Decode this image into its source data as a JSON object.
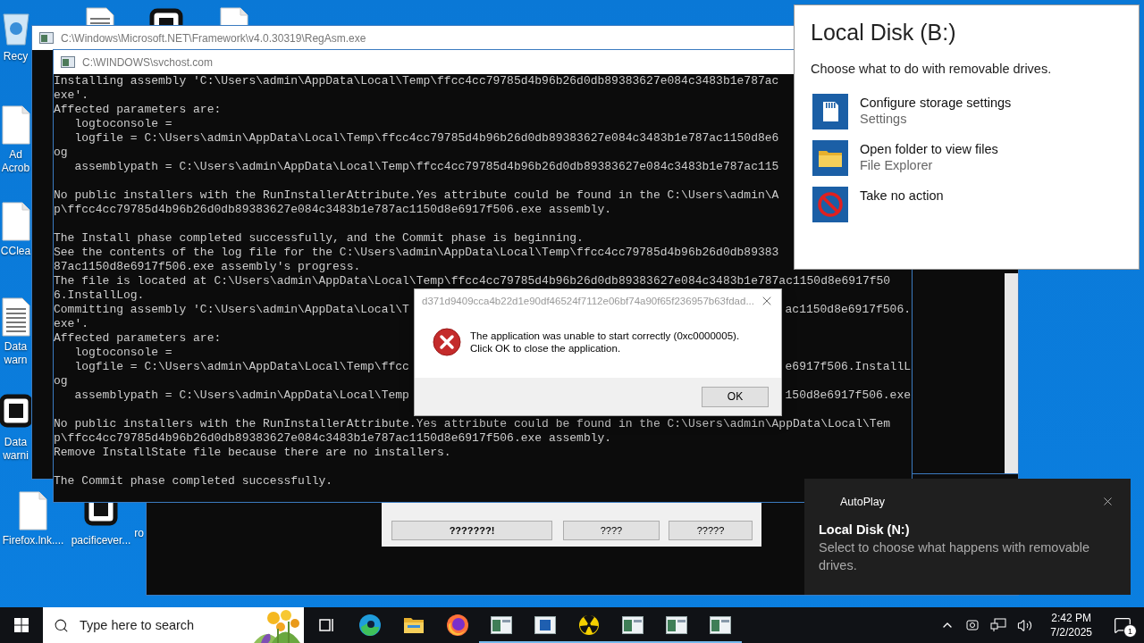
{
  "desktop_icons": [
    {
      "kind": "recycle",
      "label": [
        "Recy"
      ]
    },
    {
      "kind": "lines"
    },
    {
      "kind": "app"
    },
    {
      "kind": "file"
    },
    {
      "kind": "file",
      "label": [
        "Ad",
        "Acrob"
      ]
    },
    {
      "kind": "file",
      "label": [
        "CClea"
      ]
    },
    {
      "kind": "lines",
      "label": [
        "Data",
        "warn"
      ]
    },
    {
      "kind": "app",
      "label": [
        "Data",
        "warni"
      ]
    },
    {
      "kind": "file",
      "label": [
        "Firefox.lnk...."
      ]
    },
    {
      "kind": "app",
      "label": [
        "pacificever..."
      ]
    },
    {
      "kind": "none",
      "label": [
        "ro"
      ]
    }
  ],
  "back_window": {
    "title": "C:\\Windows\\Microsoft.NET\\Framework\\v4.0.30319\\RegAsm.exe"
  },
  "console_window": {
    "title": "C:\\WINDOWS\\svchost.com",
    "paragraphs": [
      [
        {
          "text": "Installing assembly 'C:\\Users\\admin\\AppData\\Local\\Temp\\ffcc4cc79785d4b96b26d0db89383627e084c3483b1e787ac"
        },
        {
          "text": "exe'."
        },
        {
          "text": "Affected parameters are:"
        },
        {
          "text": "   logtoconsole ="
        },
        {
          "text": "   logfile = C:\\Users\\admin\\AppData\\Local\\Temp\\ffcc4cc79785d4b96b26d0db89383627e084c3483b1e787ac1150d8e6"
        },
        {
          "text": "og"
        },
        {
          "text": "   assemblypath = C:\\Users\\admin\\AppData\\Local\\Temp\\ffcc4cc79785d4b96b26d0db89383627e084c3483b1e787ac115"
        }
      ],
      [
        {
          "text": "No public installers with the RunInstallerAttribute.Yes attribute could be found in the C:\\Users\\admin\\A"
        },
        {
          "text": "p\\ffcc4cc79785d4b96b26d0db89383627e084c3483b1e787ac1150d8e6917f506.exe assembly."
        }
      ],
      [
        {
          "text": "The Install phase completed successfully, and the Commit phase is beginning."
        },
        {
          "text": "See the contents of the log file for the C:\\Users\\admin\\AppData\\Local\\Temp\\ffcc4cc79785d4b96b26d0db89383"
        },
        {
          "text": "87ac1150d8e6917f506.exe assembly's progress."
        },
        {
          "text": "The file is located at C:\\Users\\admin\\AppData\\Local\\Temp\\ffcc4cc79785d4b96b26d0db89383627e084c3483b1e787ac1150d8e6917f50"
        },
        {
          "text": "6.InstallLog."
        },
        {
          "text": "Committing assembly 'C:\\Users\\admin\\AppData\\Local\\T",
          "tail": "ac1150d8e6917f506."
        },
        {
          "text": "exe'."
        },
        {
          "text": "Affected parameters are:"
        },
        {
          "text": "   logtoconsole ="
        },
        {
          "text": "   logfile = C:\\Users\\admin\\AppData\\Local\\Temp\\ffcc",
          "tail": "e6917f506.InstallL"
        },
        {
          "text": "og"
        },
        {
          "text": "   assemblypath = C:\\Users\\admin\\AppData\\Local\\Temp",
          "tail": "150d8e6917f506.exe"
        }
      ],
      [
        {
          "text": "No public installers with the RunInstallerAttribute.Yes attribute could be found in the C:\\Users\\admin\\AppData\\Local\\Tem"
        },
        {
          "text": "p\\ffcc4cc79785d4b96b26d0db89383627e084c3483b1e787ac1150d8e6917f506.exe assembly."
        },
        {
          "text": "Remove InstallState file because there are no installers."
        }
      ],
      [
        {
          "text": "The Commit phase completed successfully."
        }
      ]
    ]
  },
  "small_dialog": {
    "buttons": [
      {
        "label": "???????!",
        "default": true
      },
      {
        "label": "????",
        "default": false
      },
      {
        "label": "?????",
        "default": false
      }
    ]
  },
  "error_dialog": {
    "title": "d371d9409cca4b22d1e90df46524f7112e06bf74a90f65f236957b63fdad...",
    "message": [
      "The application was unable to start correctly (0xc0000005).",
      "Click OK to close the application."
    ],
    "button": "OK"
  },
  "autoplay_panel": {
    "title": "Local Disk (B:)",
    "subtitle": "Choose what to do with removable drives.",
    "options": [
      {
        "kind": "storage",
        "label": "Configure storage settings",
        "detail": "Settings"
      },
      {
        "kind": "folder",
        "label": "Open folder to view files",
        "detail": "File Explorer"
      },
      {
        "kind": "none",
        "label": "Take no action"
      }
    ]
  },
  "toast": {
    "app": "AutoPlay",
    "title": "Local Disk (N:)",
    "body": "Select to choose what happens with removable drives."
  },
  "taskbar": {
    "search_placeholder": "Type here to search",
    "apps": [
      {
        "kind": "taskview",
        "running": false
      },
      {
        "kind": "edge",
        "running": false
      },
      {
        "kind": "explorer",
        "running": false
      },
      {
        "kind": "firefox",
        "running": false
      },
      {
        "kind": "console",
        "running": true
      },
      {
        "kind": "blue",
        "running": true
      },
      {
        "kind": "hazard",
        "running": true
      },
      {
        "kind": "console",
        "running": true
      },
      {
        "kind": "console",
        "running": true
      },
      {
        "kind": "console",
        "running": true
      }
    ],
    "time": "2:42 PM",
    "date": "7/2/2025",
    "notifications": "1"
  }
}
